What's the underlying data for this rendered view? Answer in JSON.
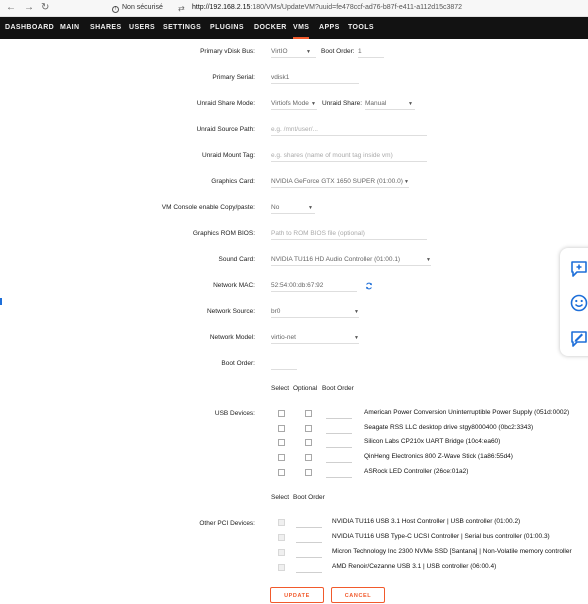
{
  "browser": {
    "security_label": "Non sécurisé",
    "url_host": "http://192.168.2.15",
    "url_path": ":180/VMs/UpdateVM?uuid=fe478ccf-ad76-b87f-e411-a112d15c3872"
  },
  "nav": {
    "items": [
      "DASHBOARD",
      "MAIN",
      "SHARES",
      "USERS",
      "SETTINGS",
      "PLUGINS",
      "DOCKER",
      "VMS",
      "APPS",
      "TOOLS"
    ],
    "active": "VMS"
  },
  "form": {
    "primary_vdisk_bus": {
      "label": "Primary vDisk Bus:",
      "value": "VirtIO",
      "boot_order_label": "Boot Order:",
      "boot_order_value": "1"
    },
    "primary_serial": {
      "label": "Primary Serial:",
      "value": "vdisk1"
    },
    "unraid_share_mode": {
      "label": "Unraid Share Mode:",
      "value": "Virtiofs Mode",
      "share_label": "Unraid Share:",
      "share_value": "Manual"
    },
    "unraid_source_path": {
      "label": "Unraid Source Path:",
      "placeholder": "e.g. /mnt/user/..."
    },
    "unraid_mount_tag": {
      "label": "Unraid Mount Tag:",
      "placeholder": "e.g. shares (name of mount tag inside vm)"
    },
    "graphics_card": {
      "label": "Graphics Card:",
      "value": "NVIDIA GeForce GTX 1650 SUPER (01:00.0)"
    },
    "vm_console_copy_paste": {
      "label": "VM Console enable Copy/paste:",
      "value": "No"
    },
    "graphics_rom_bios": {
      "label": "Graphics ROM BIOS:",
      "placeholder": "Path to ROM BIOS file (optional)"
    },
    "sound_card": {
      "label": "Sound Card:",
      "value": "NVIDIA TU116 HD Audio Controller (01:00.1)"
    },
    "network_mac": {
      "label": "Network MAC:",
      "value": "52:54:00:db:67:92"
    },
    "network_source": {
      "label": "Network Source:",
      "value": "br0"
    },
    "network_model": {
      "label": "Network Model:",
      "value": "virtio-net"
    },
    "boot_order": {
      "label": "Boot Order:"
    }
  },
  "usb": {
    "headers": {
      "select": "Select",
      "optional": "Optional",
      "boot_order": "Boot Order"
    },
    "label": "USB Devices:",
    "devices": [
      "American Power Conversion Uninterruptible Power Supply (051d:0002)",
      "Seagate RSS LLC desktop drive stgy8000400 (0bc2:3343)",
      "Silicon Labs CP210x UART Bridge (10c4:ea60)",
      "QinHeng Electronics 800 Z-Wave Stick (1a86:55d4)",
      "ASRock LED Controller (26ce:01a2)"
    ]
  },
  "pci": {
    "headers": {
      "select": "Select",
      "boot_order": "Boot Order"
    },
    "label": "Other PCI Devices:",
    "devices": [
      "NVIDIA TU116 USB 3.1 Host Controller | USB controller (01:00.2)",
      "NVIDIA TU116 USB Type-C UCSI Controller | Serial bus controller (01:00.3)",
      "Micron Technology Inc 2300 NVMe SSD [Santana] | Non-Volatile memory controller",
      "AMD Renoir/Cezanne USB 3.1 | USB controller (06:00.4)"
    ]
  },
  "buttons": {
    "update": "UPDATE",
    "cancel": "CANCEL"
  },
  "colors": {
    "accent": "#f15a2c",
    "nav_bg": "#121212",
    "floating_icons": "#1e6fd9"
  }
}
